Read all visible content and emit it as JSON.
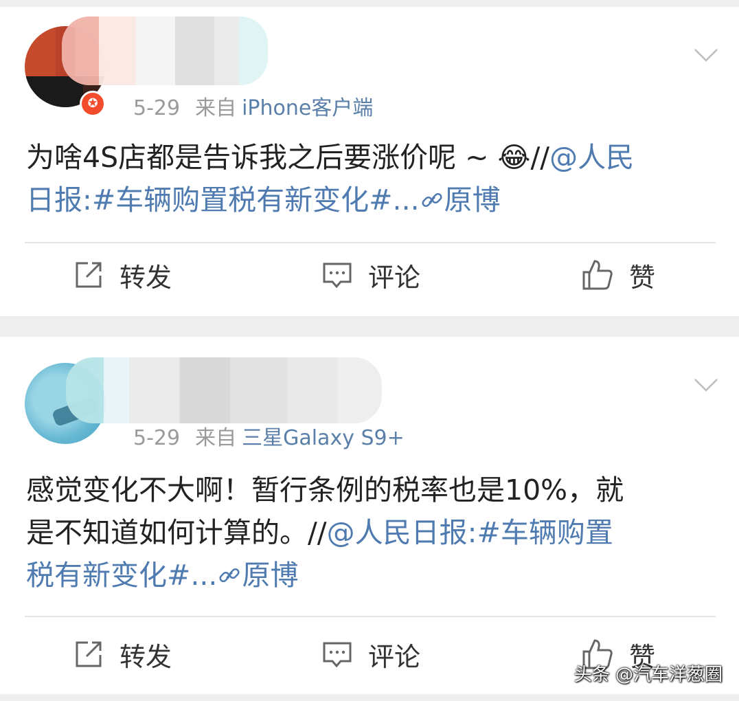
{
  "posts": [
    {
      "date": "5-29",
      "from_label": "来自",
      "source": "iPhone客户端",
      "badge": "✪",
      "text_plain": "为啥4S店都是告诉我之后要涨价呢 ~ ",
      "emoji": "😂",
      "text_sep": "//",
      "mention": "@人民日报",
      "colon": ":",
      "topic": "#车辆购置税有新变化#",
      "ellipsis": "...",
      "link_icon": "link-icon",
      "link_text": "原博"
    },
    {
      "date": "5-29",
      "from_label": "来自",
      "source": "三星Galaxy S9+",
      "text_line1": "感觉变化不大啊！暂行条例的税率也是10%，就",
      "text_line2_plain": "是不知道如何计算的。//",
      "mention": "@人民日报",
      "colon": ":",
      "topic_part1": "#车辆购置",
      "topic_part2": "税有新变化#",
      "ellipsis": "...",
      "link_icon": "link-icon",
      "link_text": "原博"
    }
  ],
  "actions": {
    "repost": "转发",
    "comment": "评论",
    "like": "赞"
  },
  "watermark": "头条 @汽车洋葱圈",
  "colors": {
    "link": "#4f7bb0",
    "meta_gray": "#9a9a9a",
    "source_blue": "#5a7fa8",
    "badge_red": "#f24c2c"
  }
}
